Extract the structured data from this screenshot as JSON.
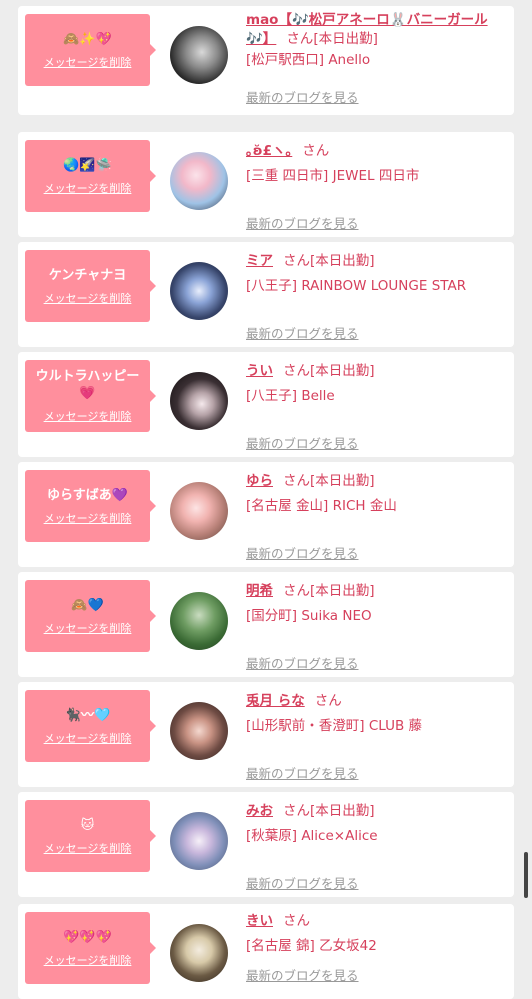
{
  "delete_label": "メッセージを削除",
  "blog_label": "最新のブログを見る",
  "san_label": "さん",
  "cards": [
    {
      "message": "🙈✨💖",
      "name": "mao【🎶松戸アネーロ🐰バニーガール🎶】",
      "status": "[本日出勤]",
      "shop": "[松戸駅西口] Anello"
    },
    {
      "message": "🌏🌠🛸",
      "name": "｡ʚ̆£ヽ｡",
      "status": "",
      "shop": "[三重 四日市] JEWEL 四日市"
    },
    {
      "message": "ケンチャナヨ",
      "name": "ミア",
      "status": "[本日出勤]",
      "shop": "[八王子] RAINBOW LOUNGE STAR"
    },
    {
      "message": "ウルトラハッピー💗",
      "name": "うい",
      "status": "[本日出勤]",
      "shop": "[八王子] Belle"
    },
    {
      "message": "ゆらすばあ💜",
      "name": "ゆら",
      "status": "[本日出勤]",
      "shop": "[名古屋 金山] RICH 金山"
    },
    {
      "message": "🙈💙",
      "name": "明希",
      "status": "[本日出勤]",
      "shop": "[国分町] Suika NEO"
    },
    {
      "message": "🐈‍⬛〰🩵",
      "name": "兎月 らな",
      "status": "",
      "shop": "[山形駅前・香澄町] CLUB 藤"
    },
    {
      "message": "🐱",
      "name": "みお",
      "status": "[本日出勤]",
      "shop": "[秋葉原] Alice×Alice"
    },
    {
      "message": "💖💖💖",
      "name": "きい",
      "status": "",
      "shop": "[名古屋 錦] 乙女坂42"
    }
  ]
}
